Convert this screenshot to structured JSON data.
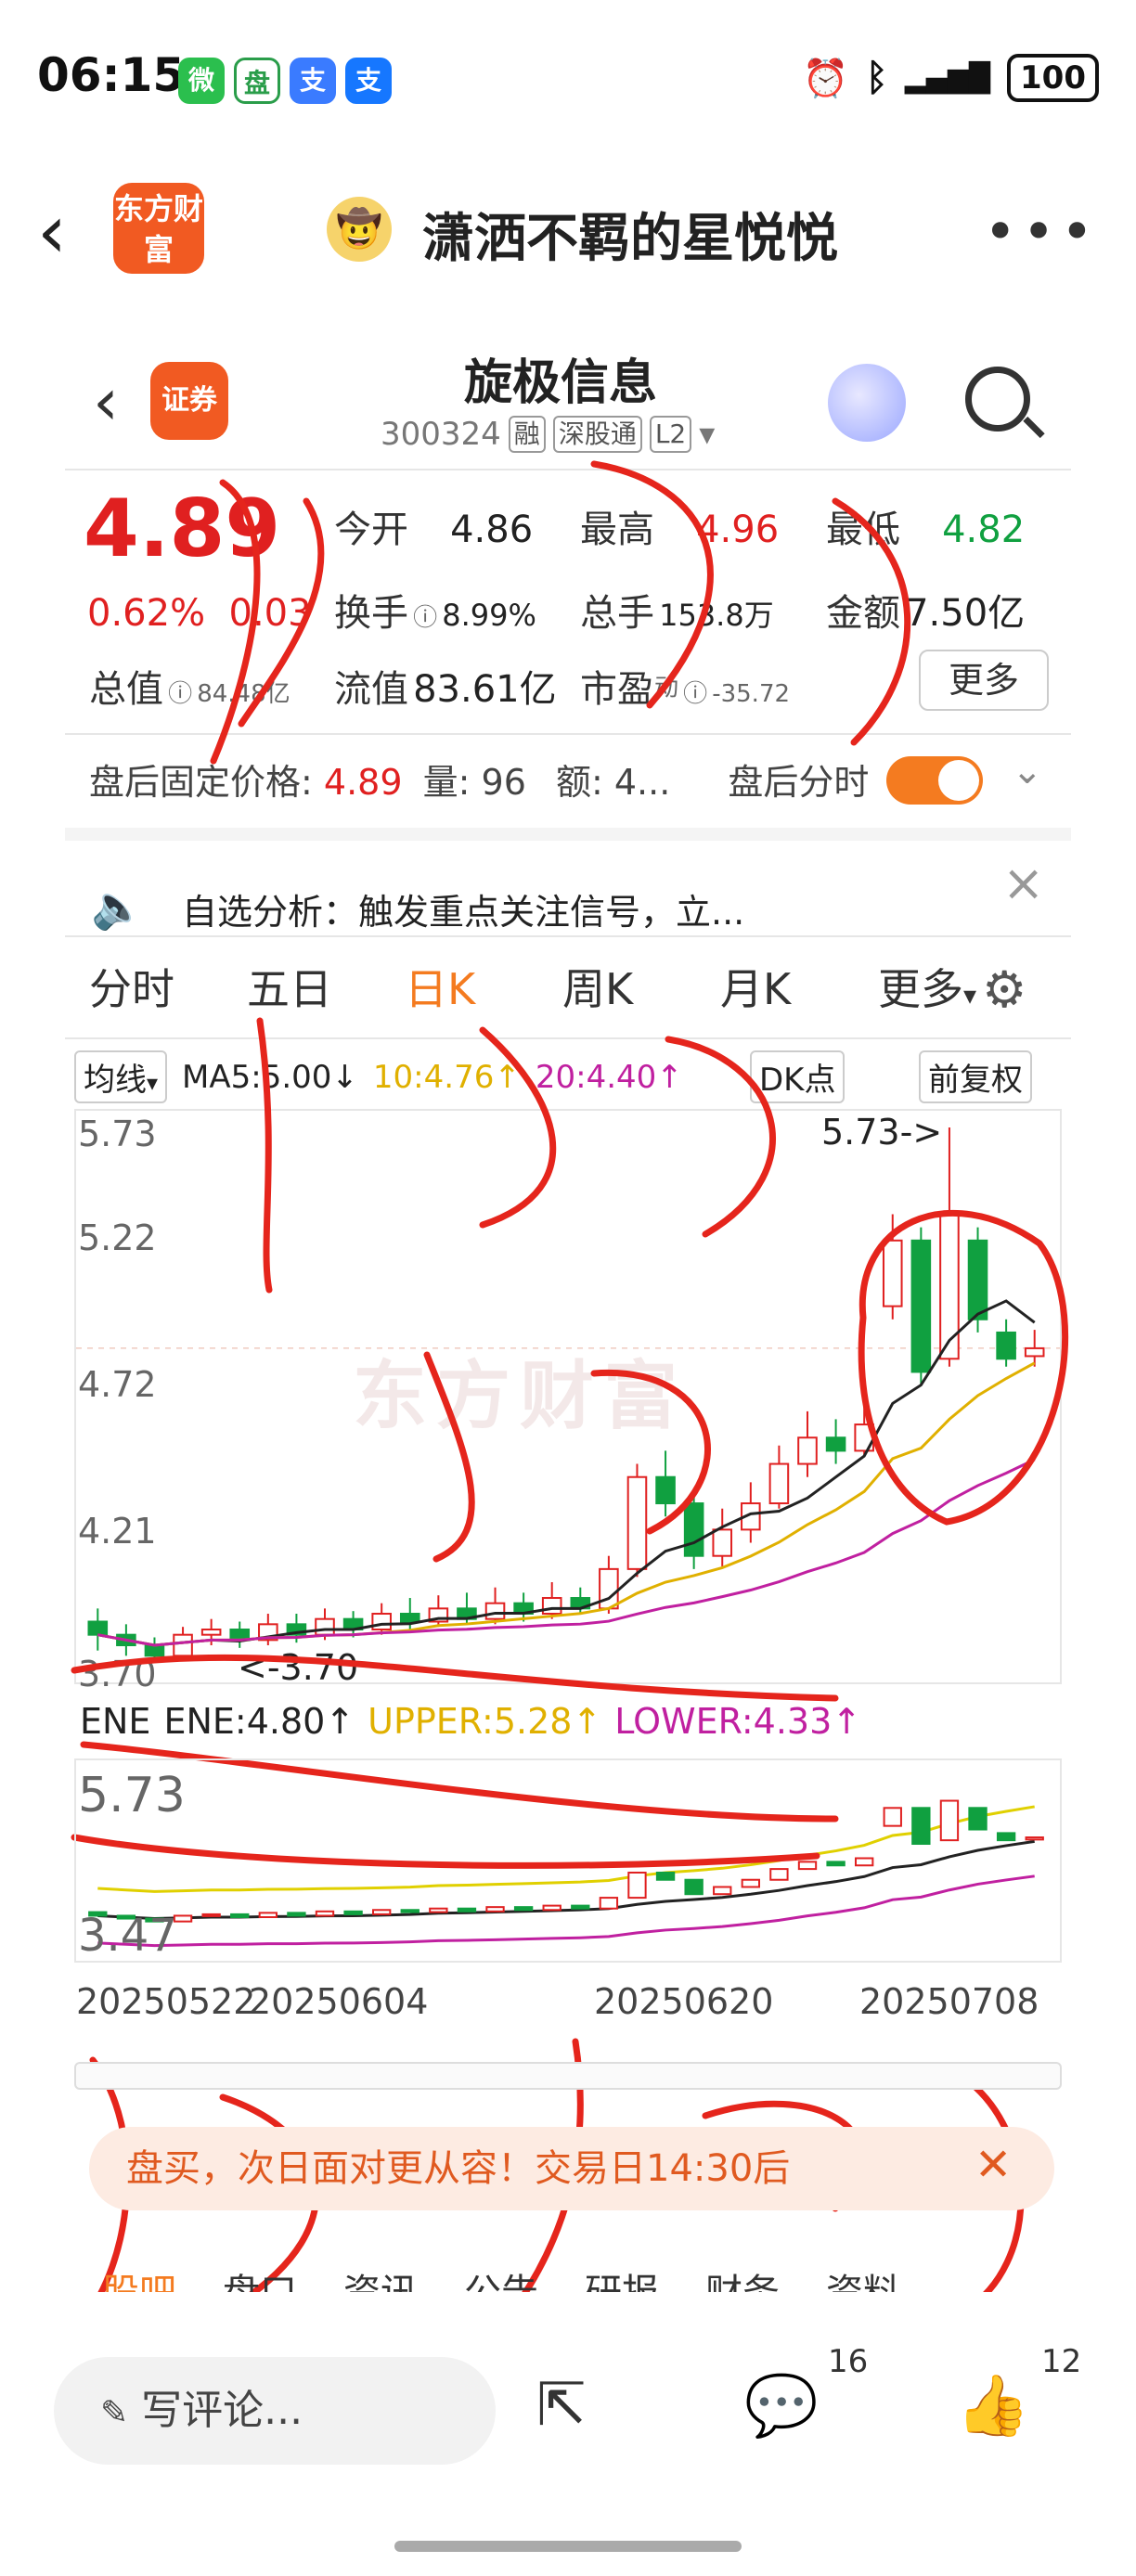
{
  "status_bar": {
    "time": "06:15",
    "apps": [
      "微",
      "盘",
      "支"
    ],
    "battery": "100"
  },
  "top_nav": {
    "app_logo": "东方财富",
    "title": "潇洒不羁的星悦悦",
    "more": "•••"
  },
  "stock": {
    "broker_logo": "证券",
    "name": "旋极信息",
    "code": "300324",
    "tags": [
      "融",
      "深股通",
      "L2"
    ],
    "price": "4.89",
    "change_pct": "0.62%",
    "change": "0.03",
    "quotes": {
      "open_label": "今开",
      "open": "4.86",
      "high_label": "最高",
      "high": "4.96",
      "low_label": "最低",
      "low": "4.82",
      "turnover_label": "换手",
      "turnover": "8.99%",
      "volume_label": "总手",
      "volume": "153.8万",
      "amount_label": "金额",
      "amount": "7.50亿",
      "mcap_label": "总值",
      "mcap": "84.48亿",
      "float_label": "流值",
      "float": "83.61亿",
      "pe_label": "市盈",
      "pe_sup": "动",
      "pe": "-35.72",
      "more": "更多"
    },
    "after_hours": {
      "label": "盘后固定价格:",
      "price": "4.89",
      "vol_label": "量:",
      "vol": "96",
      "amt_label": "额:",
      "amt": "4...",
      "timeshare_label": "盘后分时"
    },
    "alert": "自选分析：触发重点关注信号，立..."
  },
  "chart_tabs": [
    "分时",
    "五日",
    "日K",
    "周K",
    "月K",
    "更多"
  ],
  "indicators": {
    "ma_select": "均线",
    "ma5": "MA5:5.00↓",
    "ma10": "10:4.76↑",
    "ma20": "20:4.40↑",
    "dk": "DK点",
    "adjust": "前复权"
  },
  "main_chart": {
    "y_labels": [
      "5.73",
      "5.22",
      "4.72",
      "4.21",
      "3.70"
    ],
    "high_marker": "5.73->",
    "low_marker": "<-3.70"
  },
  "ene": {
    "label": "ENE",
    "ene": "ENE:4.80↑",
    "upper": "UPPER:5.28↑",
    "lower": "LOWER:4.33↑",
    "y_top": "5.73",
    "y_bottom": "3.47",
    "dates": [
      "20250522",
      "20250604",
      "20250620",
      "20250708"
    ]
  },
  "banner": "盘买，次日面对更从容！交易日14:30后",
  "bottom_tabs": [
    "股吧",
    "盘口",
    "资讯",
    "公告",
    "研报",
    "财务",
    "资料"
  ],
  "footer": {
    "comment_placeholder": "写评论...",
    "comment_count": "16",
    "like_count": "12"
  },
  "chart_data": {
    "type": "candlestick",
    "candles": [
      {
        "o": 3.85,
        "c": 3.8,
        "h": 3.9,
        "l": 3.74
      },
      {
        "o": 3.8,
        "c": 3.76,
        "h": 3.84,
        "l": 3.72
      },
      {
        "o": 3.76,
        "c": 3.72,
        "h": 3.79,
        "l": 3.7
      },
      {
        "o": 3.72,
        "c": 3.8,
        "h": 3.83,
        "l": 3.7
      },
      {
        "o": 3.8,
        "c": 3.82,
        "h": 3.86,
        "l": 3.76
      },
      {
        "o": 3.82,
        "c": 3.78,
        "h": 3.85,
        "l": 3.75
      },
      {
        "o": 3.78,
        "c": 3.84,
        "h": 3.88,
        "l": 3.76
      },
      {
        "o": 3.84,
        "c": 3.8,
        "h": 3.88,
        "l": 3.77
      },
      {
        "o": 3.8,
        "c": 3.86,
        "h": 3.9,
        "l": 3.78
      },
      {
        "o": 3.86,
        "c": 3.82,
        "h": 3.89,
        "l": 3.79
      },
      {
        "o": 3.82,
        "c": 3.88,
        "h": 3.92,
        "l": 3.8
      },
      {
        "o": 3.88,
        "c": 3.85,
        "h": 3.94,
        "l": 3.82
      },
      {
        "o": 3.85,
        "c": 3.9,
        "h": 3.95,
        "l": 3.83
      },
      {
        "o": 3.9,
        "c": 3.86,
        "h": 3.96,
        "l": 3.84
      },
      {
        "o": 3.86,
        "c": 3.92,
        "h": 3.98,
        "l": 3.84
      },
      {
        "o": 3.92,
        "c": 3.88,
        "h": 3.96,
        "l": 3.85
      },
      {
        "o": 3.88,
        "c": 3.94,
        "h": 4.0,
        "l": 3.86
      },
      {
        "o": 3.94,
        "c": 3.9,
        "h": 3.98,
        "l": 3.88
      },
      {
        "o": 3.9,
        "c": 4.05,
        "h": 4.1,
        "l": 3.88
      },
      {
        "o": 4.05,
        "c": 4.4,
        "h": 4.45,
        "l": 4.02
      },
      {
        "o": 4.4,
        "c": 4.3,
        "h": 4.5,
        "l": 4.25
      },
      {
        "o": 4.3,
        "c": 4.1,
        "h": 4.35,
        "l": 4.05
      },
      {
        "o": 4.1,
        "c": 4.2,
        "h": 4.28,
        "l": 4.06
      },
      {
        "o": 4.2,
        "c": 4.3,
        "h": 4.38,
        "l": 4.15
      },
      {
        "o": 4.3,
        "c": 4.45,
        "h": 4.52,
        "l": 4.28
      },
      {
        "o": 4.45,
        "c": 4.55,
        "h": 4.65,
        "l": 4.4
      },
      {
        "o": 4.55,
        "c": 4.5,
        "h": 4.62,
        "l": 4.45
      },
      {
        "o": 4.5,
        "c": 4.6,
        "h": 4.7,
        "l": 4.48
      },
      {
        "o": 5.05,
        "c": 5.3,
        "h": 5.4,
        "l": 5.0
      },
      {
        "o": 5.3,
        "c": 4.8,
        "h": 5.35,
        "l": 4.75
      },
      {
        "o": 4.85,
        "c": 5.4,
        "h": 5.73,
        "l": 4.82
      },
      {
        "o": 5.3,
        "c": 5.0,
        "h": 5.35,
        "l": 4.95
      },
      {
        "o": 4.95,
        "c": 4.85,
        "h": 5.0,
        "l": 4.82
      },
      {
        "o": 4.86,
        "c": 4.89,
        "h": 4.96,
        "l": 4.82
      }
    ],
    "ylim": [
      3.7,
      5.73
    ]
  }
}
